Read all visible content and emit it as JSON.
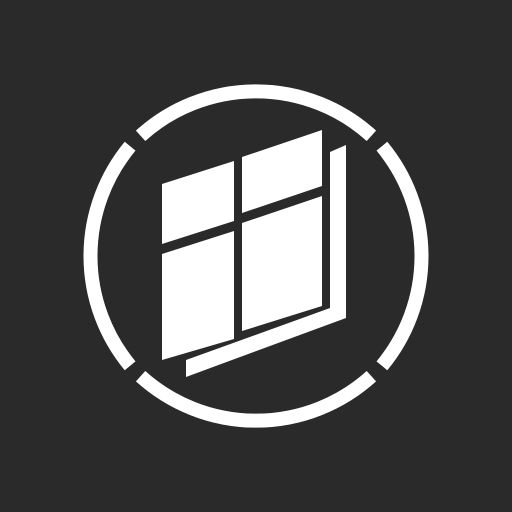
{
  "icon": {
    "name": "window-logo-icon",
    "background_color": "#2a2a2a",
    "foreground_color": "#ffffff"
  }
}
